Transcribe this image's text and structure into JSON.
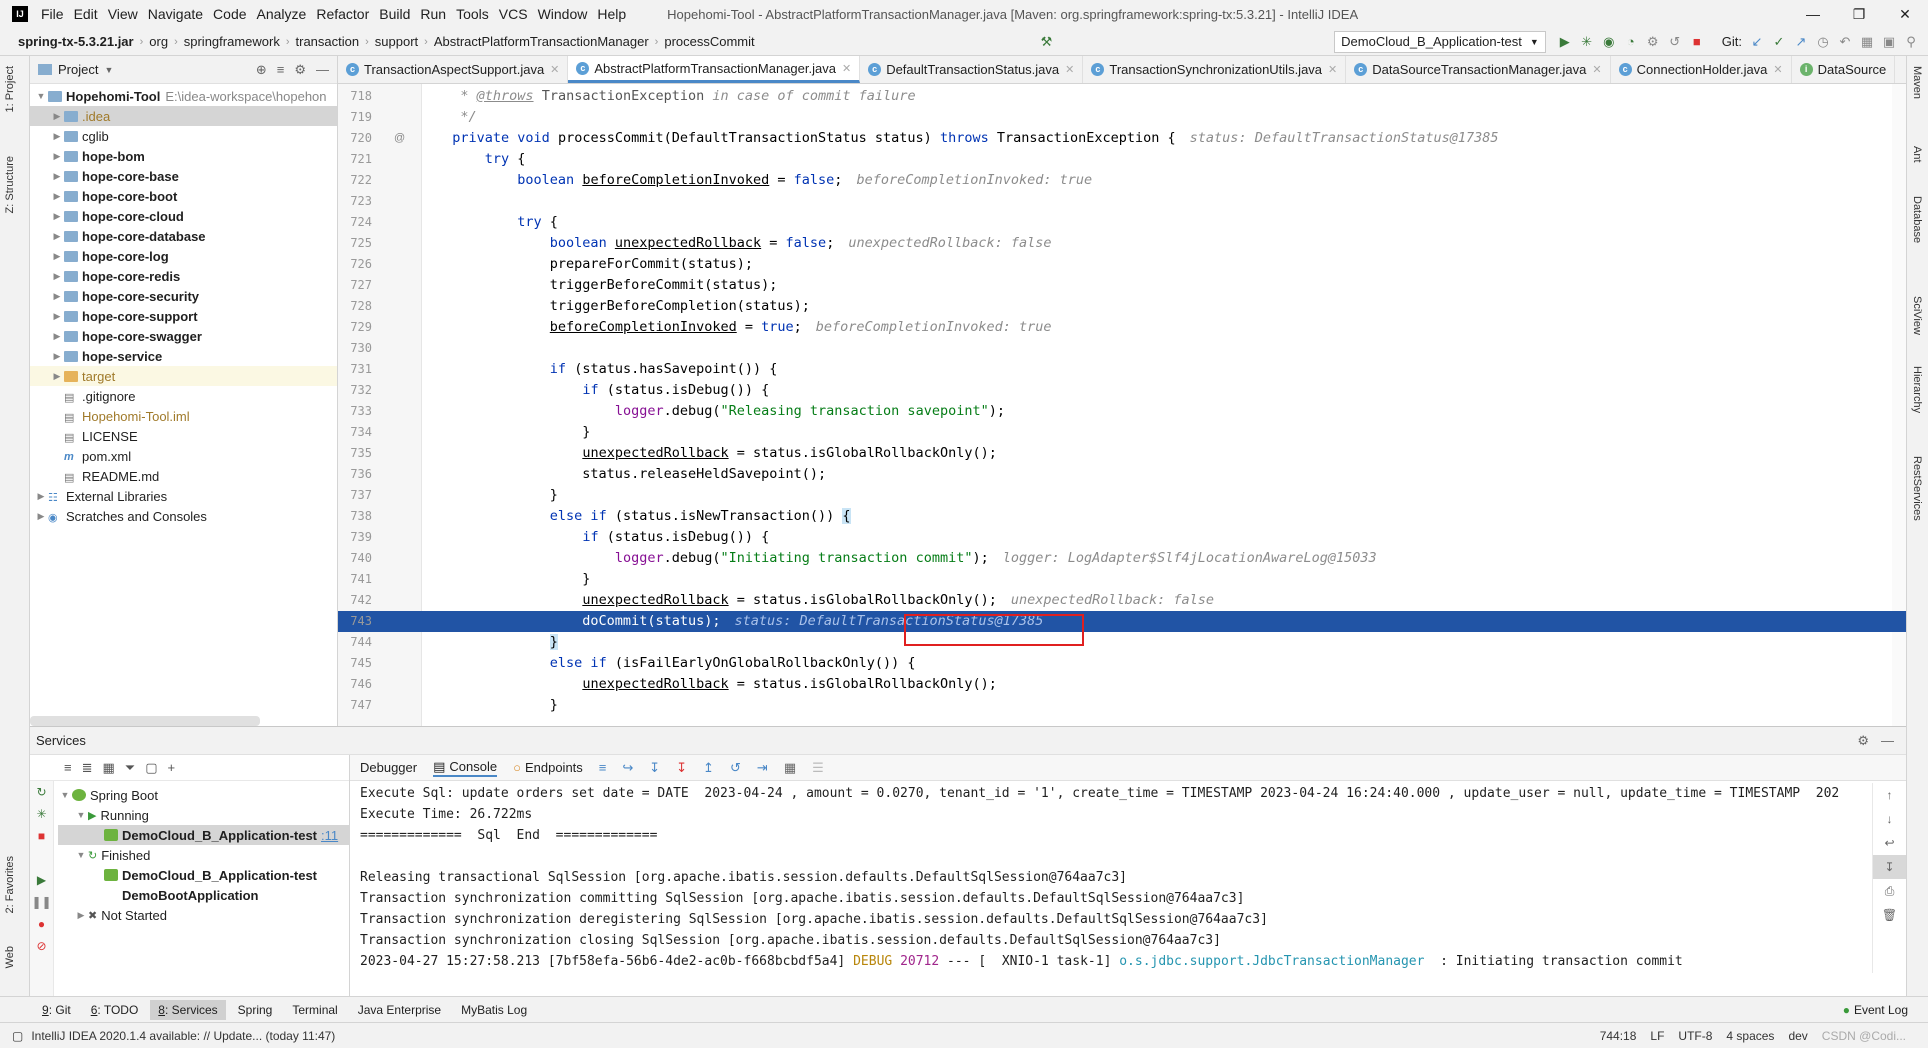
{
  "window": {
    "title": "Hopehomi-Tool - AbstractPlatformTransactionManager.java [Maven: org.springframework:spring-tx:5.3.21] - IntelliJ IDEA",
    "menu": [
      "File",
      "Edit",
      "View",
      "Navigate",
      "Code",
      "Analyze",
      "Refactor",
      "Build",
      "Run",
      "Tools",
      "VCS",
      "Window",
      "Help"
    ]
  },
  "breadcrumb": [
    "spring-tx-5.3.21.jar",
    "org",
    "springframework",
    "transaction",
    "support",
    "AbstractPlatformTransactionManager",
    "processCommit"
  ],
  "run_config": "DemoCloud_B_Application-test",
  "git_label": "Git:",
  "project": {
    "title": "Project",
    "root_name": "Hopehomi-Tool",
    "root_path": "E:\\idea-workspace\\hopehon",
    "items": [
      ".idea",
      "cglib",
      "hope-bom",
      "hope-core-base",
      "hope-core-boot",
      "hope-core-cloud",
      "hope-core-database",
      "hope-core-log",
      "hope-core-redis",
      "hope-core-security",
      "hope-core-support",
      "hope-core-swagger",
      "hope-service",
      "target",
      ".gitignore",
      "Hopehomi-Tool.iml",
      "LICENSE",
      "pom.xml",
      "README.md",
      "External Libraries",
      "Scratches and Consoles"
    ]
  },
  "tabs": [
    "TransactionAspectSupport.java",
    "AbstractPlatformTransactionManager.java",
    "DefaultTransactionStatus.java",
    "TransactionSynchronizationUtils.java",
    "DataSourceTransactionManager.java",
    "ConnectionHolder.java",
    "DataSource"
  ],
  "editor": {
    "line_numbers": [
      "718",
      "719",
      "720",
      "721",
      "722",
      "723",
      "724",
      "725",
      "726",
      "727",
      "728",
      "729",
      "730",
      "731",
      "732",
      "733",
      "734",
      "735",
      "736",
      "737",
      "738",
      "739",
      "740",
      "741",
      "742",
      "743",
      "744",
      "745",
      "746",
      "747"
    ],
    "hints": {
      "l720": "status: DefaultTransactionStatus@17385",
      "l722": "beforeCompletionInvoked: true",
      "l725": "unexpectedRollback: false",
      "l729": "beforeCompletionInvoked: true",
      "l740": "logger: LogAdapter$Slf4jLocationAwareLog@15033",
      "l742": "unexpectedRollback: false",
      "l743": "status: DefaultTransactionStatus@17385"
    }
  },
  "services": {
    "title": "Services",
    "tree": {
      "spring_boot": "Spring Boot",
      "running": "Running",
      "running_app": "DemoCloud_B_Application-test",
      "running_port": ":11",
      "finished": "Finished",
      "finished_app1": "DemoCloud_B_Application-test",
      "finished_app2": "DemoBootApplication",
      "not_started": "Not Started"
    },
    "console_tabs": [
      "Debugger",
      "Console",
      "Endpoints"
    ],
    "console_lines": [
      "Execute Sql: update orders set date = DATE  2023-04-24 , amount = 0.0270, tenant_id = '1', create_time = TIMESTAMP 2023-04-24 16:24:40.000 , update_user = null, update_time = TIMESTAMP  202",
      "Execute Time: 26.722ms",
      "=============  Sql  End  =============",
      "",
      "Releasing transactional SqlSession [org.apache.ibatis.session.defaults.DefaultSqlSession@764aa7c3]",
      "Transaction synchronization committing SqlSession [org.apache.ibatis.session.defaults.DefaultSqlSession@764aa7c3]",
      "Transaction synchronization deregistering SqlSession [org.apache.ibatis.session.defaults.DefaultSqlSession@764aa7c3]",
      "Transaction synchronization closing SqlSession [org.apache.ibatis.session.defaults.DefaultSqlSession@764aa7c3]"
    ],
    "last_line": {
      "prefix": "2023-04-27 15:27:58.213 [7bf58efa-56b6-4de2-ac0b-f668bcbdf5a4] ",
      "level": "DEBUG",
      "pid": "20712",
      "middle": " --- [  XNIO-1 task-1] ",
      "logger": "o.s.jdbc.support.JdbcTransactionManager",
      "message": "  : Initiating transaction commit"
    }
  },
  "bottom_tabs": [
    {
      "num": "9",
      "label": ": Git"
    },
    {
      "num": "6",
      "label": ": TODO"
    },
    {
      "num": "8",
      "label": ": Services"
    },
    {
      "num": "",
      "label": "Spring"
    },
    {
      "num": "",
      "label": "Terminal"
    },
    {
      "num": "",
      "label": "Java Enterprise"
    },
    {
      "num": "",
      "label": "MyBatis Log"
    }
  ],
  "event_log": "Event Log",
  "status": {
    "message": "IntelliJ IDEA 2020.1.4 available: // Update... (today 11:47)",
    "position": "744:18",
    "line_sep": "LF",
    "encoding": "UTF-8",
    "indent": "4 spaces",
    "branch": "dev",
    "watermark": "CSDN @Codi..."
  },
  "left_strip_tabs": [
    "1: Project",
    "Z: Structure",
    "2: Favorites",
    "Web"
  ],
  "right_strip_tabs": [
    "Maven",
    "Ant",
    "Database",
    "SciView",
    "Hierarchy",
    "RestServices"
  ],
  "colors": {
    "exec_line": "#2154a5",
    "keyword": "#0033b3",
    "string": "#067d17",
    "field": "#871094",
    "highlight_box": "#e02020"
  }
}
